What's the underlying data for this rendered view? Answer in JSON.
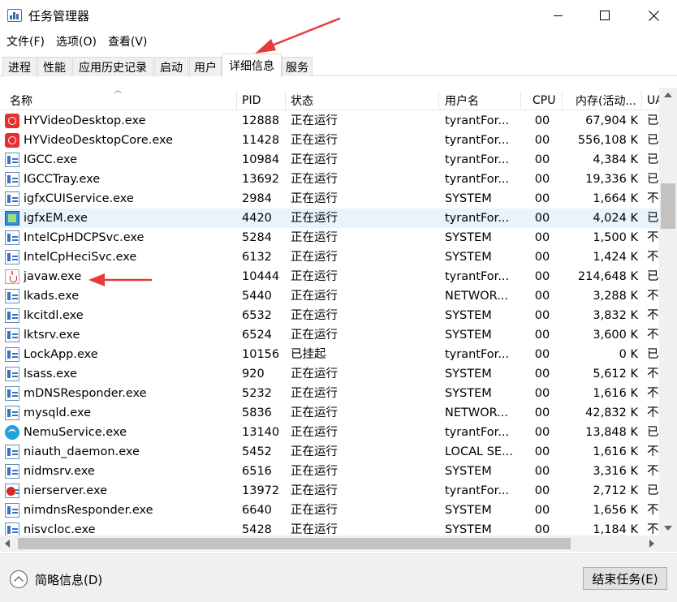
{
  "window": {
    "title": "任务管理器",
    "app_icon": "task-manager-icon",
    "controls": [
      "minimize-icon",
      "maximize-icon",
      "close-icon"
    ]
  },
  "menu": [
    {
      "label": "文件(F)"
    },
    {
      "label": "选项(O)"
    },
    {
      "label": "查看(V)"
    }
  ],
  "tabs": [
    {
      "label": "进程",
      "active": false
    },
    {
      "label": "性能",
      "active": false
    },
    {
      "label": "应用历史记录",
      "active": false
    },
    {
      "label": "启动",
      "active": false
    },
    {
      "label": "用户",
      "active": false
    },
    {
      "label": "详细信息",
      "active": true
    },
    {
      "label": "服务",
      "active": false
    }
  ],
  "table": {
    "columns": [
      "名称",
      "PID",
      "状态",
      "用户名",
      "CPU",
      "内存(活动...",
      "UA"
    ],
    "sort_column": "名称",
    "rows": [
      {
        "name": "HYVideoDesktop.exe",
        "pid": "12888",
        "status": "正在运行",
        "user": "tyrantFor...",
        "cpu": "00",
        "mem": "67,904 K",
        "uac": "已",
        "icon": "hy"
      },
      {
        "name": "HYVideoDesktopCore.exe",
        "pid": "11428",
        "status": "正在运行",
        "user": "tyrantFor...",
        "cpu": "00",
        "mem": "556,108 K",
        "uac": "已",
        "icon": "hy"
      },
      {
        "name": "IGCC.exe",
        "pid": "10984",
        "status": "正在运行",
        "user": "tyrantFor...",
        "cpu": "00",
        "mem": "4,384 K",
        "uac": "已",
        "icon": "app"
      },
      {
        "name": "IGCCTray.exe",
        "pid": "13692",
        "status": "正在运行",
        "user": "tyrantFor...",
        "cpu": "00",
        "mem": "19,336 K",
        "uac": "已",
        "icon": "app"
      },
      {
        "name": "igfxCUIService.exe",
        "pid": "2984",
        "status": "正在运行",
        "user": "SYSTEM",
        "cpu": "00",
        "mem": "1,664 K",
        "uac": "不",
        "icon": "app"
      },
      {
        "name": "igfxEM.exe",
        "pid": "4420",
        "status": "正在运行",
        "user": "tyrantFor...",
        "cpu": "00",
        "mem": "4,024 K",
        "uac": "已",
        "icon": "intel",
        "selected": true
      },
      {
        "name": "IntelCpHDCPSvc.exe",
        "pid": "5284",
        "status": "正在运行",
        "user": "SYSTEM",
        "cpu": "00",
        "mem": "1,500 K",
        "uac": "不",
        "icon": "app"
      },
      {
        "name": "IntelCpHeciSvc.exe",
        "pid": "6132",
        "status": "正在运行",
        "user": "SYSTEM",
        "cpu": "00",
        "mem": "1,424 K",
        "uac": "不",
        "icon": "app"
      },
      {
        "name": "javaw.exe",
        "pid": "10444",
        "status": "正在运行",
        "user": "tyrantFor...",
        "cpu": "00",
        "mem": "214,648 K",
        "uac": "已",
        "icon": "java"
      },
      {
        "name": "lkads.exe",
        "pid": "5440",
        "status": "正在运行",
        "user": "NETWOR...",
        "cpu": "00",
        "mem": "3,288 K",
        "uac": "不",
        "icon": "app"
      },
      {
        "name": "lkcitdl.exe",
        "pid": "6532",
        "status": "正在运行",
        "user": "SYSTEM",
        "cpu": "00",
        "mem": "3,832 K",
        "uac": "不",
        "icon": "app"
      },
      {
        "name": "lktsrv.exe",
        "pid": "6524",
        "status": "正在运行",
        "user": "SYSTEM",
        "cpu": "00",
        "mem": "3,600 K",
        "uac": "不",
        "icon": "app"
      },
      {
        "name": "LockApp.exe",
        "pid": "10156",
        "status": "已挂起",
        "user": "tyrantFor...",
        "cpu": "00",
        "mem": "0 K",
        "uac": "已",
        "icon": "app"
      },
      {
        "name": "lsass.exe",
        "pid": "920",
        "status": "正在运行",
        "user": "SYSTEM",
        "cpu": "00",
        "mem": "5,612 K",
        "uac": "不",
        "icon": "app"
      },
      {
        "name": "mDNSResponder.exe",
        "pid": "5232",
        "status": "正在运行",
        "user": "SYSTEM",
        "cpu": "00",
        "mem": "1,616 K",
        "uac": "不",
        "icon": "app"
      },
      {
        "name": "mysqld.exe",
        "pid": "5836",
        "status": "正在运行",
        "user": "NETWOR...",
        "cpu": "00",
        "mem": "42,832 K",
        "uac": "不",
        "icon": "app"
      },
      {
        "name": "NemuService.exe",
        "pid": "13140",
        "status": "正在运行",
        "user": "tyrantFor...",
        "cpu": "00",
        "mem": "13,848 K",
        "uac": "已",
        "icon": "nemu"
      },
      {
        "name": "niauth_daemon.exe",
        "pid": "5452",
        "status": "正在运行",
        "user": "LOCAL SE...",
        "cpu": "00",
        "mem": "1,616 K",
        "uac": "不",
        "icon": "app"
      },
      {
        "name": "nidmsrv.exe",
        "pid": "6516",
        "status": "正在运行",
        "user": "SYSTEM",
        "cpu": "00",
        "mem": "3,316 K",
        "uac": "不",
        "icon": "app"
      },
      {
        "name": "nierserver.exe",
        "pid": "13972",
        "status": "正在运行",
        "user": "tyrantFor...",
        "cpu": "00",
        "mem": "2,712 K",
        "uac": "已",
        "icon": "nier"
      },
      {
        "name": "nimdnsResponder.exe",
        "pid": "6640",
        "status": "正在运行",
        "user": "SYSTEM",
        "cpu": "00",
        "mem": "1,656 K",
        "uac": "不",
        "icon": "app"
      },
      {
        "name": "nisvcloc.exe",
        "pid": "5428",
        "status": "正在运行",
        "user": "SYSTEM",
        "cpu": "00",
        "mem": "1,184 K",
        "uac": "不",
        "icon": "app"
      }
    ]
  },
  "footer": {
    "fewer_details": "简略信息(D)",
    "end_task": "结束任务(E)"
  },
  "colors": {
    "selected_row": "#e9f3fb",
    "annotation_arrow": "#e83a3a"
  }
}
